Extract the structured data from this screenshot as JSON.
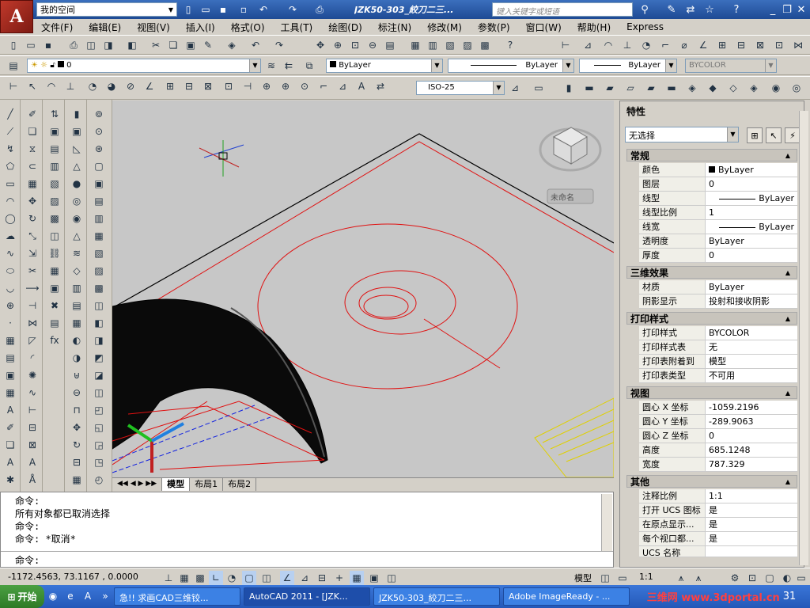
{
  "titlebar": {
    "logo": "A",
    "workspace": "我的空间",
    "window_title": "JZK50-303_絞刀二三...",
    "search_placeholder": "键入关键字或短语"
  },
  "menus": [
    "文件(F)",
    "编辑(E)",
    "视图(V)",
    "插入(I)",
    "格式(O)",
    "工具(T)",
    "绘图(D)",
    "标注(N)",
    "修改(M)",
    "参数(P)",
    "窗口(W)",
    "帮助(H)",
    "Express"
  ],
  "layer_toolbar": {
    "layer_value": "0",
    "color_value": "ByLayer",
    "linetype_value": "ByLayer",
    "lineweight_value": "ByLayer",
    "plotstyle_value": "BYCOLOR"
  },
  "dim_toolbar": {
    "dimstyle": "ISO-25"
  },
  "viewcube": {
    "label": "未命名"
  },
  "layout_tabs": [
    "模型",
    "布局1",
    "布局2"
  ],
  "command_lines": [
    "命令:",
    "所有对象都已取消选择",
    "命令:",
    "命令: *取消*"
  ],
  "command_prompt": "命令:",
  "status": {
    "coords": "-1172.4563, 73.1167 , 0.0000",
    "model_label": "模型",
    "scale": "1:1"
  },
  "properties": {
    "title": "特性",
    "selection": "无选择",
    "sections": [
      {
        "name": "常规",
        "rows": [
          {
            "k": "颜色",
            "v": "ByLayer"
          },
          {
            "k": "图层",
            "v": "0"
          },
          {
            "k": "线型",
            "v": "ByLayer"
          },
          {
            "k": "线型比例",
            "v": "1"
          },
          {
            "k": "线宽",
            "v": "ByLayer"
          },
          {
            "k": "透明度",
            "v": "ByLayer"
          },
          {
            "k": "厚度",
            "v": "0"
          }
        ]
      },
      {
        "name": "三维效果",
        "rows": [
          {
            "k": "材质",
            "v": "ByLayer"
          },
          {
            "k": "阴影显示",
            "v": "投射和接收阴影"
          }
        ]
      },
      {
        "name": "打印样式",
        "rows": [
          {
            "k": "打印样式",
            "v": "BYCOLOR"
          },
          {
            "k": "打印样式表",
            "v": "无"
          },
          {
            "k": "打印表附着到",
            "v": "模型"
          },
          {
            "k": "打印表类型",
            "v": "不可用"
          }
        ]
      },
      {
        "name": "视图",
        "rows": [
          {
            "k": "圆心 X 坐标",
            "v": "-1059.2196"
          },
          {
            "k": "圆心 Y 坐标",
            "v": "-289.9063"
          },
          {
            "k": "圆心 Z 坐标",
            "v": "0"
          },
          {
            "k": "高度",
            "v": "685.1248"
          },
          {
            "k": "宽度",
            "v": "787.329"
          }
        ]
      },
      {
        "name": "其他",
        "rows": [
          {
            "k": "注释比例",
            "v": "1:1"
          },
          {
            "k": "打开 UCS 图标",
            "v": "是"
          },
          {
            "k": "在原点显示...",
            "v": "是"
          },
          {
            "k": "每个视口都...",
            "v": "是"
          },
          {
            "k": "UCS 名称",
            "v": ""
          }
        ]
      }
    ]
  },
  "taskbar": {
    "start": "开始",
    "tasks": [
      "急!! 求画CAD三维铰...",
      "AutoCAD 2011 - [JZK...",
      "JZK50-303_絞刀二三...",
      "Adobe ImageReady - ..."
    ],
    "watermark": "三维网 www.3dportal.cn",
    "clock": "31"
  },
  "colors": {
    "drawing_bg": "#c7c7c7",
    "red_lines": "#e01010",
    "accent": "#1e4a94"
  }
}
